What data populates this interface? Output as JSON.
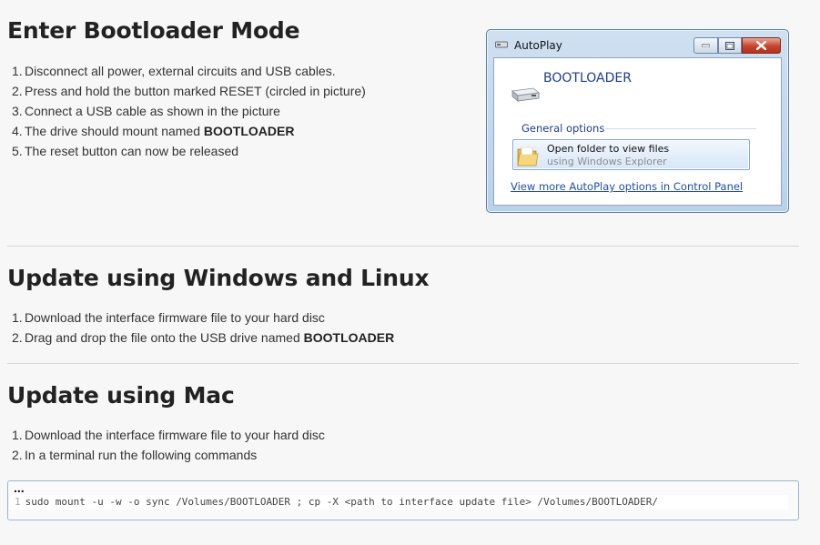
{
  "sections": [
    {
      "title": "Enter Bootloader Mode",
      "steps": [
        {
          "num": "1.",
          "text": "Disconnect all power, external circuits and USB cables.",
          "bold": ""
        },
        {
          "num": "2.",
          "text": "Press and hold the button marked RESET (circled in picture)",
          "bold": ""
        },
        {
          "num": "3.",
          "text": "Connect a USB cable as shown in the picture",
          "bold": ""
        },
        {
          "num": "4.",
          "text": "The drive should mount named ",
          "bold": "BOOTLOADER"
        },
        {
          "num": "5.",
          "text": "The reset button can now be released",
          "bold": ""
        }
      ]
    },
    {
      "title": "Update using Windows and Linux",
      "steps": [
        {
          "num": "1.",
          "text": "Download the interface firmware file to your hard disc",
          "bold": ""
        },
        {
          "num": "2.",
          "text": "Drag and drop the file onto the USB drive named ",
          "bold": "BOOTLOADER"
        }
      ]
    },
    {
      "title": "Update using Mac",
      "steps": [
        {
          "num": "1.",
          "text": "Download the interface firmware file to your hard disc",
          "bold": ""
        },
        {
          "num": "2.",
          "text": "In a terminal run the following commands",
          "bold": ""
        }
      ]
    }
  ],
  "autoplay": {
    "window_title": "AutoPlay",
    "drive_name": "BOOTLOADER",
    "group_label": "General options",
    "option_title": "Open folder to view files",
    "option_subtitle": "using Windows Explorer",
    "more_link": "View more AutoPlay options in Control Panel"
  },
  "code": {
    "header": "...",
    "line_number": "1",
    "command": "sudo mount -u -w -o sync /Volumes/BOOTLOADER ; cp -X <path to interface update file> /Volumes/BOOTLOADER/"
  },
  "colors": {
    "link": "#1e4fa8",
    "heading": "#222222",
    "window_border": "#5a7fa3"
  }
}
